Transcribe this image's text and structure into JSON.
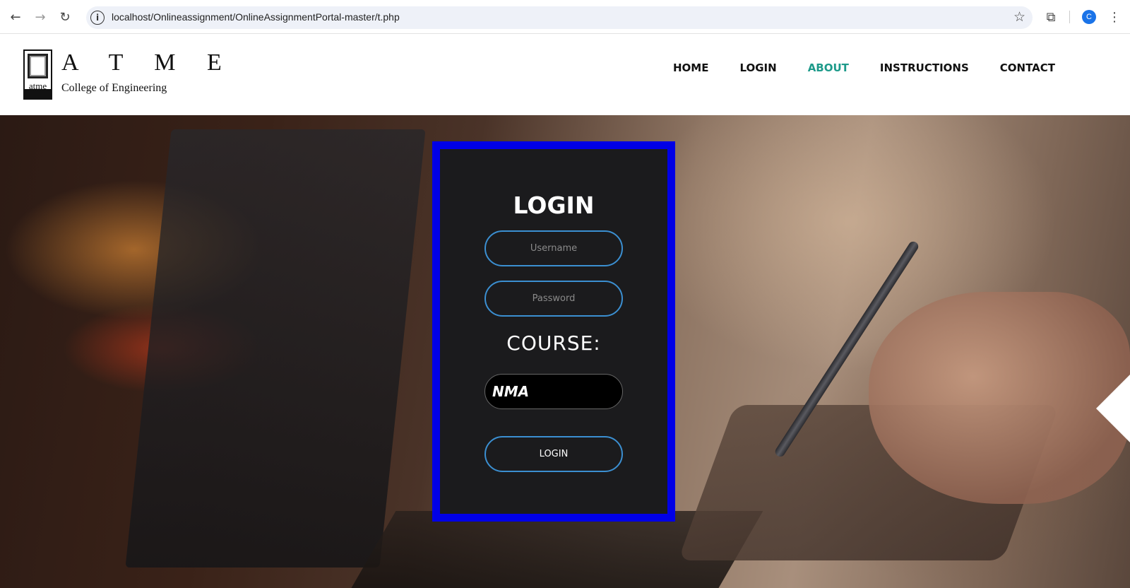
{
  "browser": {
    "url": "localhost/Onlineassignment/OnlineAssignmentPortal-master/t.php",
    "back_icon": "arrow-left",
    "forward_icon": "arrow-right",
    "reload_icon": "reload",
    "profile_initial": "C"
  },
  "site": {
    "brand_name": "A T M E",
    "brand_sub": "College of Engineering",
    "logo_word": "atme",
    "nav": [
      {
        "label": "HOME",
        "active": false
      },
      {
        "label": "LOGIN",
        "active": false
      },
      {
        "label": "ABOUT",
        "active": true
      },
      {
        "label": "INSTRUCTIONS",
        "active": false
      },
      {
        "label": "CONTACT",
        "active": false
      }
    ],
    "accent_color": "#1d9a8a"
  },
  "login": {
    "title": "LOGIN",
    "username_placeholder": "Username",
    "password_placeholder": "Password",
    "course_label": "COURSE:",
    "course_value": "NMA",
    "button_label": "LOGIN",
    "card_border_color": "#0000e6",
    "field_border_color": "#3b8fd1"
  }
}
